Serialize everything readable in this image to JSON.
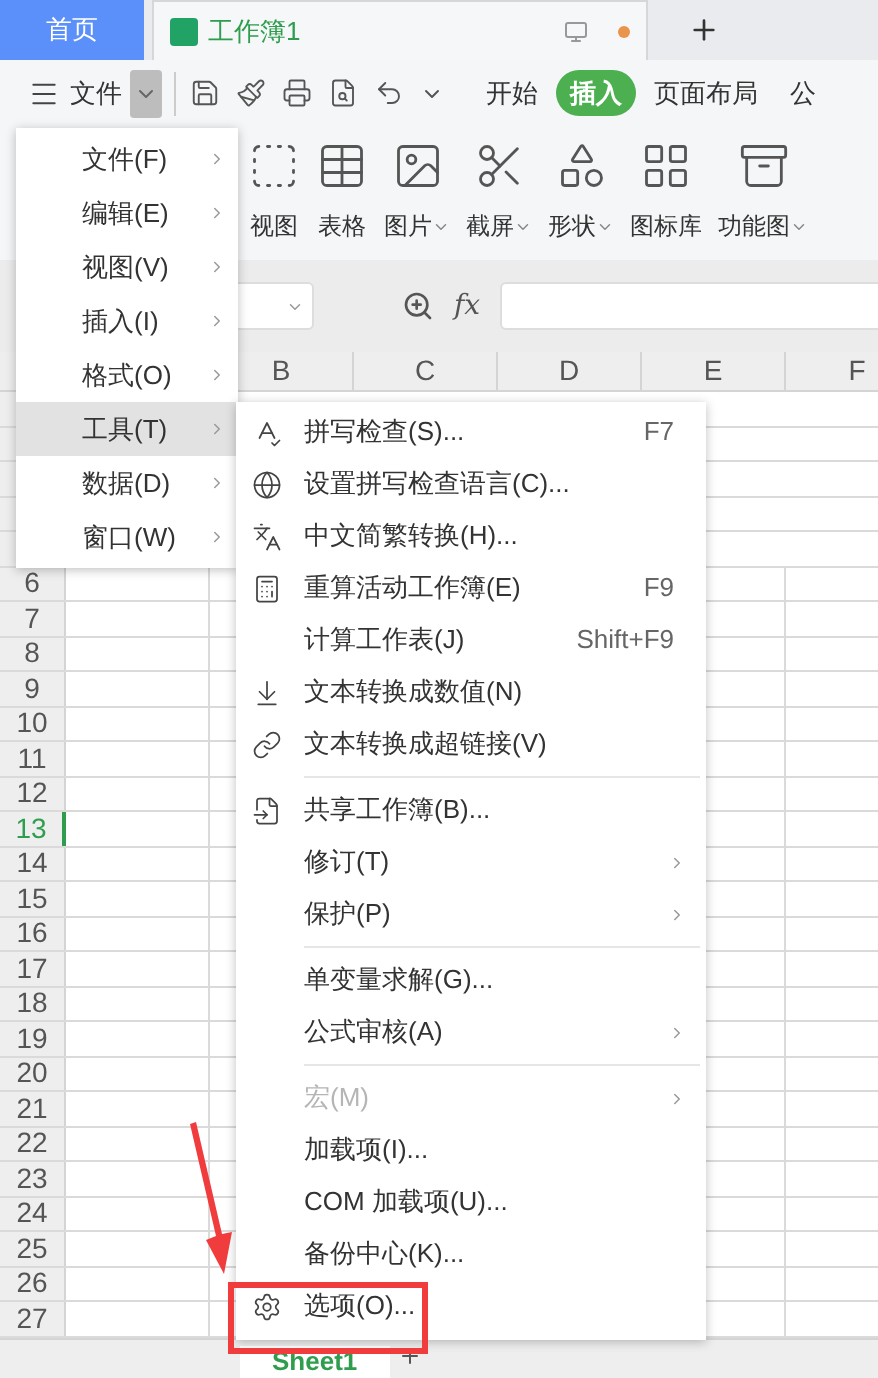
{
  "tabs": [
    {
      "label": "首页",
      "selected": false
    },
    {
      "label": "工作簿1",
      "selected": true
    }
  ],
  "toolbar": {
    "menu_label": "文件",
    "ribbon_tabs": [
      {
        "label": "开始",
        "selected": false
      },
      {
        "label": "插入",
        "selected": true
      },
      {
        "label": "页面布局",
        "selected": false
      },
      {
        "label": "公",
        "selected": false
      }
    ]
  },
  "ribbon": [
    {
      "label": "视图",
      "dropdown": false
    },
    {
      "label": "表格",
      "dropdown": false
    },
    {
      "label": "图片",
      "dropdown": true
    },
    {
      "label": "截屏",
      "dropdown": true
    },
    {
      "label": "形状",
      "dropdown": true
    },
    {
      "label": "图标库",
      "dropdown": false
    },
    {
      "label": "功能图",
      "dropdown": true
    }
  ],
  "formula_bar": {
    "fx": "fx"
  },
  "columns": [
    "B",
    "C",
    "D",
    "E",
    "F"
  ],
  "rows": [
    {
      "label": "6",
      "selected": false
    },
    {
      "label": "7",
      "selected": false
    },
    {
      "label": "8",
      "selected": false
    },
    {
      "label": "9",
      "selected": false
    },
    {
      "label": "10",
      "selected": false
    },
    {
      "label": "11",
      "selected": false
    },
    {
      "label": "12",
      "selected": false
    },
    {
      "label": "13",
      "selected": true
    },
    {
      "label": "14",
      "selected": false
    },
    {
      "label": "15",
      "selected": false
    },
    {
      "label": "16",
      "selected": false
    },
    {
      "label": "17",
      "selected": false
    },
    {
      "label": "18",
      "selected": false
    },
    {
      "label": "19",
      "selected": false
    },
    {
      "label": "20",
      "selected": false
    },
    {
      "label": "21",
      "selected": false
    },
    {
      "label": "22",
      "selected": false
    },
    {
      "label": "23",
      "selected": false
    },
    {
      "label": "24",
      "selected": false
    },
    {
      "label": "25",
      "selected": false
    },
    {
      "label": "26",
      "selected": false
    },
    {
      "label": "27",
      "selected": false
    }
  ],
  "sheet_tabs": [
    {
      "label": "Sheet1",
      "selected": true
    }
  ],
  "menu": [
    {
      "label": "文件(F)",
      "selected": false
    },
    {
      "label": "编辑(E)",
      "selected": false
    },
    {
      "label": "视图(V)",
      "selected": false
    },
    {
      "label": "插入(I)",
      "selected": false
    },
    {
      "label": "格式(O)",
      "selected": false
    },
    {
      "label": "工具(T)",
      "selected": true
    },
    {
      "label": "数据(D)",
      "selected": false
    },
    {
      "label": "窗口(W)",
      "selected": false
    }
  ],
  "submenu": [
    {
      "kind": "item",
      "label": "拼写检查(S)...",
      "shortcut": "F7",
      "submenu": false,
      "disabled": false,
      "highlighted": false
    },
    {
      "kind": "item",
      "label": "设置拼写检查语言(C)...",
      "submenu": false,
      "disabled": false,
      "highlighted": false
    },
    {
      "kind": "item",
      "label": "中文简繁转换(H)...",
      "submenu": false,
      "disabled": false,
      "highlighted": false
    },
    {
      "kind": "item",
      "label": "重算活动工作簿(E)",
      "shortcut": "F9",
      "submenu": false,
      "disabled": false,
      "highlighted": false
    },
    {
      "kind": "item",
      "label": "计算工作表(J)",
      "shortcut": "Shift+F9",
      "submenu": false,
      "disabled": false,
      "highlighted": false
    },
    {
      "kind": "item",
      "label": "文本转换成数值(N)",
      "submenu": false,
      "disabled": false,
      "highlighted": false
    },
    {
      "kind": "item",
      "label": "文本转换成超链接(V)",
      "submenu": false,
      "disabled": false,
      "highlighted": false
    },
    {
      "kind": "separator"
    },
    {
      "kind": "item",
      "label": "共享工作簿(B)...",
      "submenu": false,
      "disabled": false,
      "highlighted": false
    },
    {
      "kind": "item",
      "label": "修订(T)",
      "submenu": true,
      "disabled": false,
      "highlighted": false
    },
    {
      "kind": "item",
      "label": "保护(P)",
      "submenu": true,
      "disabled": false,
      "highlighted": false
    },
    {
      "kind": "separator"
    },
    {
      "kind": "item",
      "label": "单变量求解(G)...",
      "submenu": false,
      "disabled": false,
      "highlighted": false
    },
    {
      "kind": "item",
      "label": "公式审核(A)",
      "submenu": true,
      "disabled": false,
      "highlighted": false
    },
    {
      "kind": "separator"
    },
    {
      "kind": "item",
      "label": "宏(M)",
      "submenu": true,
      "disabled": true,
      "highlighted": false
    },
    {
      "kind": "item",
      "label": "加载项(I)...",
      "submenu": false,
      "disabled": false,
      "highlighted": false
    },
    {
      "kind": "item",
      "label": "COM 加载项(U)...",
      "submenu": false,
      "disabled": false,
      "highlighted": false
    },
    {
      "kind": "item",
      "label": "备份中心(K)...",
      "submenu": false,
      "disabled": false,
      "highlighted": false
    },
    {
      "kind": "item",
      "label": "选项(O)...",
      "submenu": false,
      "disabled": false,
      "highlighted": true
    }
  ]
}
